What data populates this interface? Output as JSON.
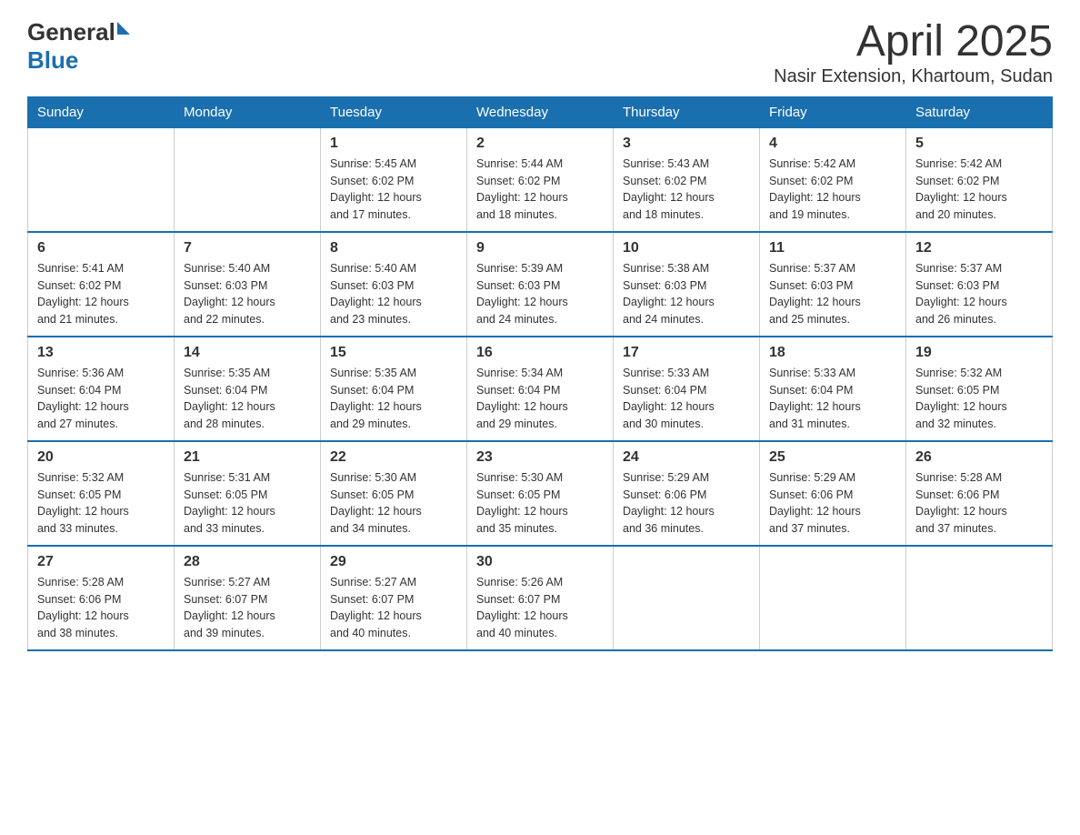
{
  "logo": {
    "general": "General",
    "blue": "Blue"
  },
  "title": "April 2025",
  "subtitle": "Nasir Extension, Khartoum, Sudan",
  "header_days": [
    "Sunday",
    "Monday",
    "Tuesday",
    "Wednesday",
    "Thursday",
    "Friday",
    "Saturday"
  ],
  "weeks": [
    [
      {
        "day": "",
        "info": ""
      },
      {
        "day": "",
        "info": ""
      },
      {
        "day": "1",
        "info": "Sunrise: 5:45 AM\nSunset: 6:02 PM\nDaylight: 12 hours\nand 17 minutes."
      },
      {
        "day": "2",
        "info": "Sunrise: 5:44 AM\nSunset: 6:02 PM\nDaylight: 12 hours\nand 18 minutes."
      },
      {
        "day": "3",
        "info": "Sunrise: 5:43 AM\nSunset: 6:02 PM\nDaylight: 12 hours\nand 18 minutes."
      },
      {
        "day": "4",
        "info": "Sunrise: 5:42 AM\nSunset: 6:02 PM\nDaylight: 12 hours\nand 19 minutes."
      },
      {
        "day": "5",
        "info": "Sunrise: 5:42 AM\nSunset: 6:02 PM\nDaylight: 12 hours\nand 20 minutes."
      }
    ],
    [
      {
        "day": "6",
        "info": "Sunrise: 5:41 AM\nSunset: 6:02 PM\nDaylight: 12 hours\nand 21 minutes."
      },
      {
        "day": "7",
        "info": "Sunrise: 5:40 AM\nSunset: 6:03 PM\nDaylight: 12 hours\nand 22 minutes."
      },
      {
        "day": "8",
        "info": "Sunrise: 5:40 AM\nSunset: 6:03 PM\nDaylight: 12 hours\nand 23 minutes."
      },
      {
        "day": "9",
        "info": "Sunrise: 5:39 AM\nSunset: 6:03 PM\nDaylight: 12 hours\nand 24 minutes."
      },
      {
        "day": "10",
        "info": "Sunrise: 5:38 AM\nSunset: 6:03 PM\nDaylight: 12 hours\nand 24 minutes."
      },
      {
        "day": "11",
        "info": "Sunrise: 5:37 AM\nSunset: 6:03 PM\nDaylight: 12 hours\nand 25 minutes."
      },
      {
        "day": "12",
        "info": "Sunrise: 5:37 AM\nSunset: 6:03 PM\nDaylight: 12 hours\nand 26 minutes."
      }
    ],
    [
      {
        "day": "13",
        "info": "Sunrise: 5:36 AM\nSunset: 6:04 PM\nDaylight: 12 hours\nand 27 minutes."
      },
      {
        "day": "14",
        "info": "Sunrise: 5:35 AM\nSunset: 6:04 PM\nDaylight: 12 hours\nand 28 minutes."
      },
      {
        "day": "15",
        "info": "Sunrise: 5:35 AM\nSunset: 6:04 PM\nDaylight: 12 hours\nand 29 minutes."
      },
      {
        "day": "16",
        "info": "Sunrise: 5:34 AM\nSunset: 6:04 PM\nDaylight: 12 hours\nand 29 minutes."
      },
      {
        "day": "17",
        "info": "Sunrise: 5:33 AM\nSunset: 6:04 PM\nDaylight: 12 hours\nand 30 minutes."
      },
      {
        "day": "18",
        "info": "Sunrise: 5:33 AM\nSunset: 6:04 PM\nDaylight: 12 hours\nand 31 minutes."
      },
      {
        "day": "19",
        "info": "Sunrise: 5:32 AM\nSunset: 6:05 PM\nDaylight: 12 hours\nand 32 minutes."
      }
    ],
    [
      {
        "day": "20",
        "info": "Sunrise: 5:32 AM\nSunset: 6:05 PM\nDaylight: 12 hours\nand 33 minutes."
      },
      {
        "day": "21",
        "info": "Sunrise: 5:31 AM\nSunset: 6:05 PM\nDaylight: 12 hours\nand 33 minutes."
      },
      {
        "day": "22",
        "info": "Sunrise: 5:30 AM\nSunset: 6:05 PM\nDaylight: 12 hours\nand 34 minutes."
      },
      {
        "day": "23",
        "info": "Sunrise: 5:30 AM\nSunset: 6:05 PM\nDaylight: 12 hours\nand 35 minutes."
      },
      {
        "day": "24",
        "info": "Sunrise: 5:29 AM\nSunset: 6:06 PM\nDaylight: 12 hours\nand 36 minutes."
      },
      {
        "day": "25",
        "info": "Sunrise: 5:29 AM\nSunset: 6:06 PM\nDaylight: 12 hours\nand 37 minutes."
      },
      {
        "day": "26",
        "info": "Sunrise: 5:28 AM\nSunset: 6:06 PM\nDaylight: 12 hours\nand 37 minutes."
      }
    ],
    [
      {
        "day": "27",
        "info": "Sunrise: 5:28 AM\nSunset: 6:06 PM\nDaylight: 12 hours\nand 38 minutes."
      },
      {
        "day": "28",
        "info": "Sunrise: 5:27 AM\nSunset: 6:07 PM\nDaylight: 12 hours\nand 39 minutes."
      },
      {
        "day": "29",
        "info": "Sunrise: 5:27 AM\nSunset: 6:07 PM\nDaylight: 12 hours\nand 40 minutes."
      },
      {
        "day": "30",
        "info": "Sunrise: 5:26 AM\nSunset: 6:07 PM\nDaylight: 12 hours\nand 40 minutes."
      },
      {
        "day": "",
        "info": ""
      },
      {
        "day": "",
        "info": ""
      },
      {
        "day": "",
        "info": ""
      }
    ]
  ]
}
